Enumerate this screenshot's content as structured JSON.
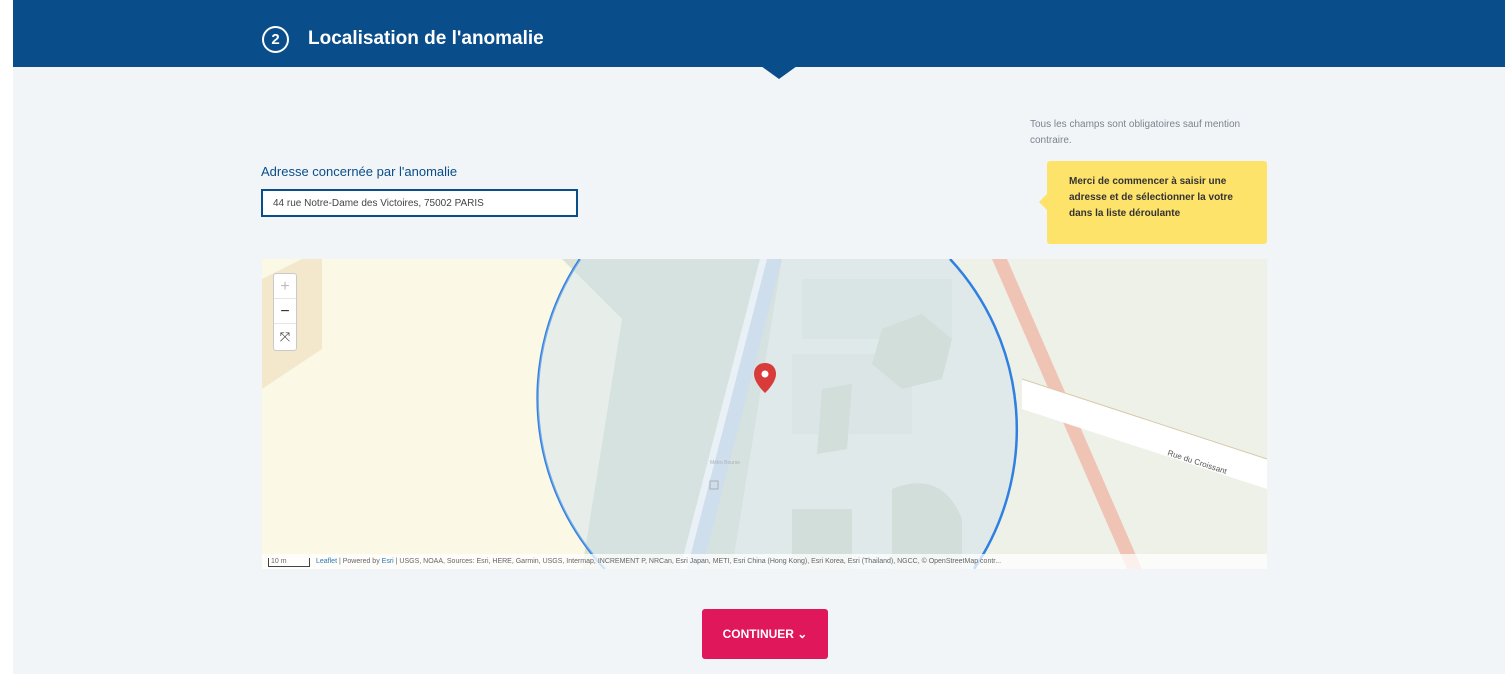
{
  "step": {
    "number": "2",
    "title": "Localisation de l'anomalie"
  },
  "mandatory_note": "Tous les champs sont obligatoires sauf mention contraire.",
  "address": {
    "label": "Adresse concernée par l'anomalie",
    "value": "44 rue Notre-Dame des Victoires, 75002 PARIS"
  },
  "tooltip": "Merci de commencer à saisir une adresse et de sélectionner la votre dans la liste déroulante",
  "map": {
    "zoom_in": "+",
    "zoom_out": "−",
    "fullscreen": "⤧",
    "scale": "10 m",
    "attribution_leaflet": "Leaflet",
    "attribution_powered": " | Powered by ",
    "attribution_esri": "Esri",
    "attribution_sources": " | USGS, NOAA, Sources: Esri, HERE, Garmin, USGS, Intermap, INCREMENT P, NRCan, Esri Japan, METI, Esri China (Hong Kong), Esri Korea, Esri (Thailand), NGCC, © OpenStreetMap contr...",
    "street_label": "Rue du Croissant",
    "metro_label": "Métro Bourse",
    "colors": {
      "radius": "#2f80e0",
      "marker": "#d93a3a"
    }
  },
  "continue_label": "CONTINUER ⌄",
  "colors": {
    "primary": "#0a4d8b",
    "accent": "#e0175a",
    "tooltip": "#fde36a"
  }
}
